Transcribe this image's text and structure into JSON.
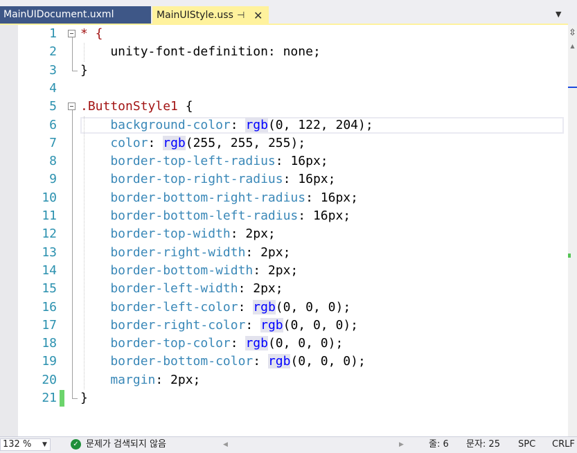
{
  "tabs": {
    "inactive_label": "MainUIDocument.uxml",
    "active_label": "MainUIStyle.uss",
    "pin_glyph": "⊣",
    "close_glyph": "✕",
    "dropdown_glyph": "▼"
  },
  "editor": {
    "line_numbers": [
      "1",
      "2",
      "3",
      "4",
      "5",
      "6",
      "7",
      "8",
      "9",
      "10",
      "11",
      "12",
      "13",
      "14",
      "15",
      "16",
      "17",
      "18",
      "19",
      "20",
      "21"
    ],
    "lines": [
      [
        {
          "t": "* {",
          "c": "sel"
        }
      ],
      [
        {
          "t": "    unity-font-definition: none;",
          "c": ""
        }
      ],
      [
        {
          "t": "}",
          "c": ""
        }
      ],
      [],
      [
        {
          "t": ".ButtonStyle1",
          "c": "sel"
        },
        {
          "t": " {",
          "c": ""
        }
      ],
      [
        {
          "t": "    background-color",
          "c": "prop"
        },
        {
          "t": ": ",
          "c": ""
        },
        {
          "t": "rgb",
          "c": "fn"
        },
        {
          "t": "(0, 122, 204);",
          "c": ""
        }
      ],
      [
        {
          "t": "    color",
          "c": "prop"
        },
        {
          "t": ": ",
          "c": ""
        },
        {
          "t": "rgb",
          "c": "fn"
        },
        {
          "t": "(255, 255, 255);",
          "c": ""
        }
      ],
      [
        {
          "t": "    border-top-left-radius",
          "c": "prop"
        },
        {
          "t": ": 16px;",
          "c": ""
        }
      ],
      [
        {
          "t": "    border-top-right-radius",
          "c": "prop"
        },
        {
          "t": ": 16px;",
          "c": ""
        }
      ],
      [
        {
          "t": "    border-bottom-right-radius",
          "c": "prop"
        },
        {
          "t": ": 16px;",
          "c": ""
        }
      ],
      [
        {
          "t": "    border-bottom-left-radius",
          "c": "prop"
        },
        {
          "t": ": 16px;",
          "c": ""
        }
      ],
      [
        {
          "t": "    border-top-width",
          "c": "prop"
        },
        {
          "t": ": 2px;",
          "c": ""
        }
      ],
      [
        {
          "t": "    border-right-width",
          "c": "prop"
        },
        {
          "t": ": 2px;",
          "c": ""
        }
      ],
      [
        {
          "t": "    border-bottom-width",
          "c": "prop"
        },
        {
          "t": ": 2px;",
          "c": ""
        }
      ],
      [
        {
          "t": "    border-left-width",
          "c": "prop"
        },
        {
          "t": ": 2px;",
          "c": ""
        }
      ],
      [
        {
          "t": "    border-left-color",
          "c": "prop"
        },
        {
          "t": ": ",
          "c": ""
        },
        {
          "t": "rgb",
          "c": "fn"
        },
        {
          "t": "(0, 0, 0);",
          "c": ""
        }
      ],
      [
        {
          "t": "    border-right-color",
          "c": "prop"
        },
        {
          "t": ": ",
          "c": ""
        },
        {
          "t": "rgb",
          "c": "fn"
        },
        {
          "t": "(0, 0, 0);",
          "c": ""
        }
      ],
      [
        {
          "t": "    border-top-color",
          "c": "prop"
        },
        {
          "t": ": ",
          "c": ""
        },
        {
          "t": "rgb",
          "c": "fn"
        },
        {
          "t": "(0, 0, 0);",
          "c": ""
        }
      ],
      [
        {
          "t": "    border-bottom-color",
          "c": "prop"
        },
        {
          "t": ": ",
          "c": ""
        },
        {
          "t": "rgb",
          "c": "fn"
        },
        {
          "t": "(0, 0, 0);",
          "c": ""
        }
      ],
      [
        {
          "t": "    margin",
          "c": "prop"
        },
        {
          "t": ": 2px;",
          "c": ""
        }
      ],
      [
        {
          "t": "}",
          "c": ""
        }
      ]
    ]
  },
  "status": {
    "zoom": "132 %",
    "zoom_arrow": "▼",
    "issues_icon_glyph": "✓",
    "issues_text": "문제가 검색되지 않음",
    "line": "줄: 6",
    "column": "문자: 25",
    "whitespace": "SPC",
    "line_ending": "CRLF",
    "scroll_left_glyph": "◀",
    "scroll_right_glyph": "▶"
  },
  "scrollbar": {
    "split_glyph": "⇳",
    "up_glyph": "▲"
  },
  "colors": {
    "active_tab": "#fff29d",
    "inactive_tab": "#3e5787",
    "line_number": "#2b91af",
    "property": "#3a88b8",
    "selector": "#a31515",
    "function": "#0000ff",
    "change_bar": "#6cd46c"
  }
}
